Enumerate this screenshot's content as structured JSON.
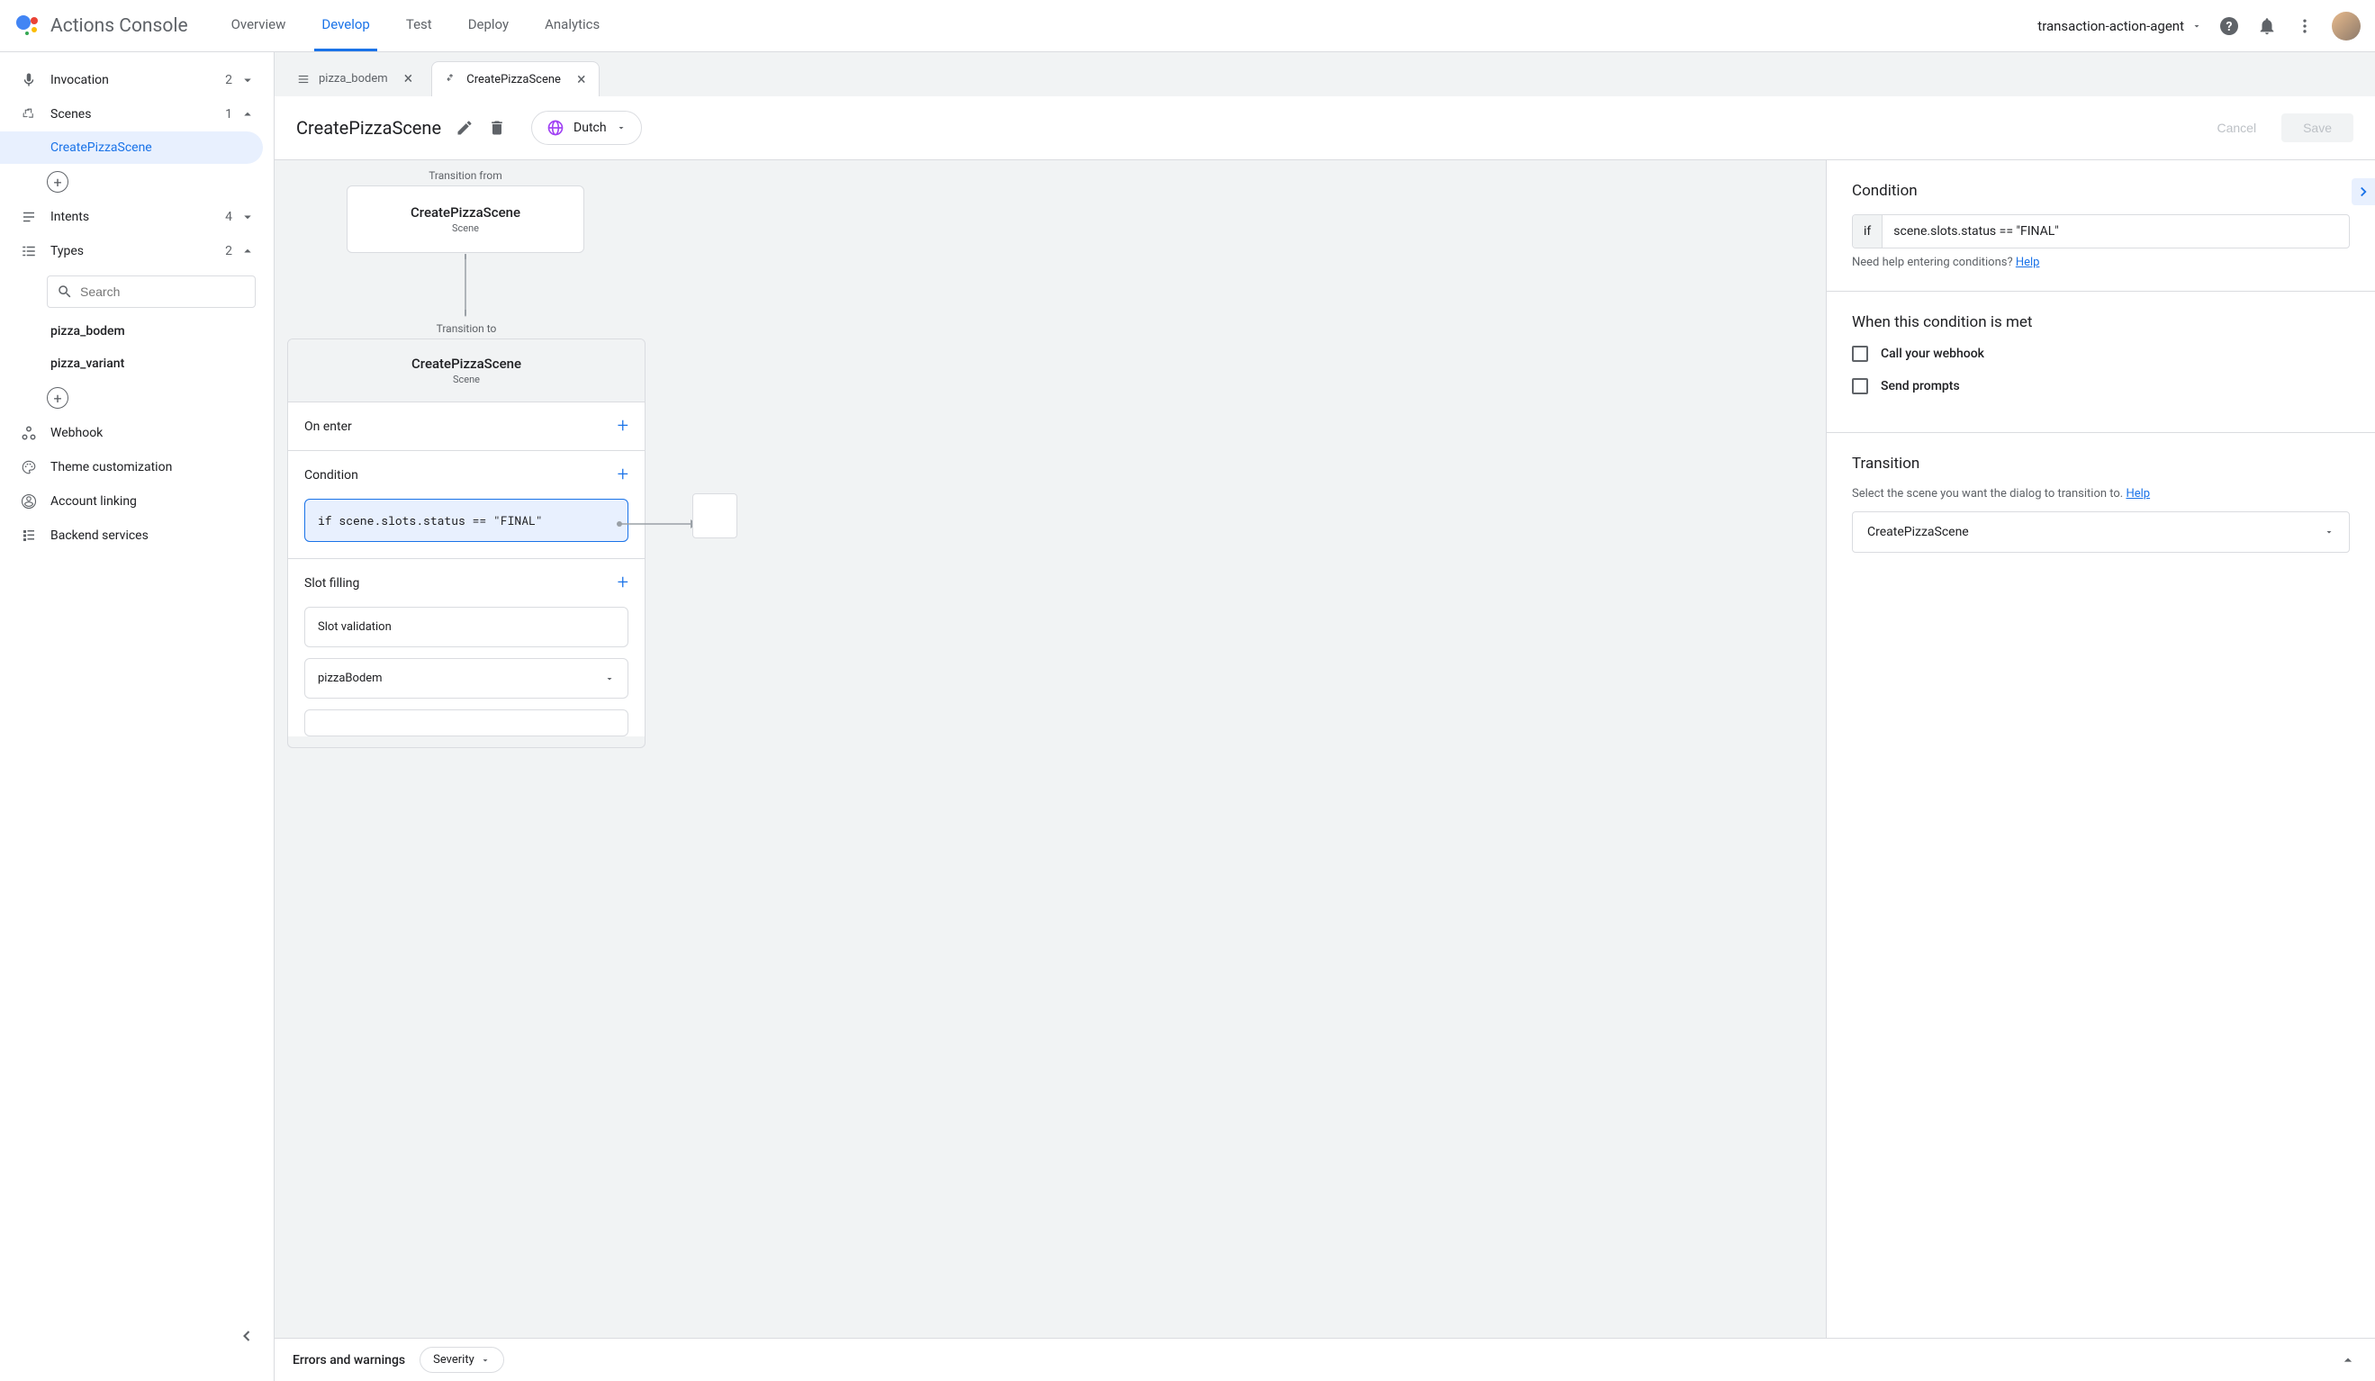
{
  "header": {
    "product": "Actions Console",
    "tabs": [
      "Overview",
      "Develop",
      "Test",
      "Deploy",
      "Analytics"
    ],
    "active_tab": "Develop",
    "project": "transaction-action-agent"
  },
  "sidebar": {
    "items": [
      {
        "label": "Invocation",
        "count": "2",
        "icon": "mic"
      },
      {
        "label": "Scenes",
        "count": "1",
        "icon": "scene",
        "expanded": true
      },
      {
        "label": "Intents",
        "count": "4",
        "icon": "intent"
      },
      {
        "label": "Types",
        "count": "2",
        "icon": "type",
        "expanded": true
      }
    ],
    "scene_items": [
      "CreatePizzaScene"
    ],
    "search_placeholder": "Search",
    "type_items": [
      "pizza_bodem",
      "pizza_variant"
    ],
    "bottom": [
      "Webhook",
      "Theme customization",
      "Account linking",
      "Backend services"
    ]
  },
  "file_tabs": [
    {
      "label": "pizza_bodem",
      "icon": "type"
    },
    {
      "label": "CreatePizzaScene",
      "icon": "scene",
      "active": true
    }
  ],
  "toolbar": {
    "title": "CreatePizzaScene",
    "language": "Dutch",
    "cancel": "Cancel",
    "save": "Save"
  },
  "canvas": {
    "transition_from_label": "Transition from",
    "transition_from_title": "CreatePizzaScene",
    "transition_from_sub": "Scene",
    "transition_to_label": "Transition to",
    "transition_to_title": "CreatePizzaScene",
    "transition_to_sub": "Scene",
    "on_enter": "On enter",
    "condition_label": "Condition",
    "condition_text": "if scene.slots.status == \"FINAL\"",
    "slot_filling": "Slot filling",
    "slot_validation": "Slot validation",
    "slot_name": "pizzaBodem"
  },
  "panel": {
    "condition_title": "Condition",
    "if": "if",
    "expr": "scene.slots.status == \"FINAL\"",
    "help_prefix": "Need help entering conditions? ",
    "help": "Help",
    "when_met": "When this condition is met",
    "call_webhook": "Call your webhook",
    "send_prompts": "Send prompts",
    "transition_title": "Transition",
    "transition_desc": "Select the scene you want the dialog to transition to. ",
    "transition_help": "Help",
    "transition_value": "CreatePizzaScene"
  },
  "bottom": {
    "title": "Errors and warnings",
    "severity": "Severity"
  }
}
